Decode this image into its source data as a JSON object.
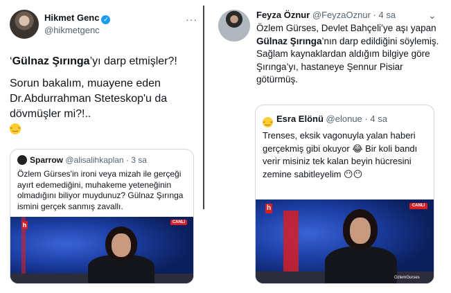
{
  "left_tweet": {
    "author": "Hikmet Genc",
    "handle": "@hikmetgenc",
    "more": "···",
    "line1_prefix": "‘",
    "line1_bold": "Gülnaz Şırınga",
    "line1_suffix": "’yı darp etmişler?!",
    "body": "Sorun bakalım, muayene eden Dr.Abdurrahman Steteskop'u da dövmüşler mi?!..",
    "emoji": "😁",
    "quote": {
      "author": "Sparrow",
      "handle": "@alisalihkaplan",
      "time": "· 3 sa",
      "text": "Özlem Gürses'in ironi veya mizah ile gerçeği ayırt edemediğini, muhakeme yeteneğinin olmadığını biliyor muydunuz? Gülnaz Şırınga ismini gerçek sanmış zavallı.",
      "media": {
        "live": "CANLI",
        "logo": "h"
      }
    }
  },
  "right_tweet": {
    "author": "Feyza Öznur",
    "handle": "@FeyzaOznur",
    "time": "· 4 sa",
    "more": "⌄",
    "text_prefix": "Özlem Gürses, Devlet Bahçeli’ye aşı yapan ",
    "text_bold": "Gülnaz Şırınga",
    "text_suffix": "’nın darp edildiğini söylemiş. Sağlam kaynaklardan aldığım bilgiye göre Şırınga’yı, hastaneye Şennur Pisiar götürmüş.",
    "quote": {
      "author": "Esra Elönü",
      "handle": "@elonue",
      "time": "· 4 sa",
      "text": "Trenses, eksik vagonuyla yalan haberi gerçekmiş gibi okuyor 😂 Bir koli bandı verir misiniz tek kalan beyin hücresini zemine sabitleyelim 😶😶",
      "media": {
        "live": "CANLI",
        "logo": "h",
        "caption": "OzlemGurses"
      }
    }
  }
}
